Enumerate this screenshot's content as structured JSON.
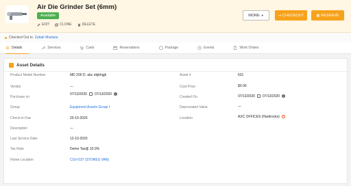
{
  "header": {
    "title": "Air Die Grinder Set (6mm)",
    "status_badge": "Available",
    "actions": {
      "edit": "EDIT",
      "clone": "CLONE",
      "delete": "DELETE"
    },
    "more_label": "MORE",
    "checkout_label": "CHECKOUT",
    "reserve_label": "RESERVE"
  },
  "checked_out": {
    "prefix": "Checked Out to",
    "person": "Zubair Murtaza"
  },
  "tabs": [
    {
      "label": "Details",
      "icon": "list-icon",
      "active": true
    },
    {
      "label": "Services",
      "icon": "wrench-icon"
    },
    {
      "label": "Carts",
      "icon": "cart-icon"
    },
    {
      "label": "Reservations",
      "icon": "calendar-icon"
    },
    {
      "label": "Package",
      "icon": "package-icon"
    },
    {
      "label": "Events",
      "icon": "history-icon"
    },
    {
      "label": "Work Orders",
      "icon": "clipboard-icon"
    }
  ],
  "asset_details": {
    "title": "Asset Details",
    "left": [
      {
        "label": "Product Model Number",
        "value": "MD 200 D. abc nbjkhgjk"
      },
      {
        "label": "Vendor",
        "value": "---"
      },
      {
        "label": "Purchase on",
        "date1": "07/13/2020",
        "date2": "07/13/2020"
      },
      {
        "label": "Group",
        "value": "Equipment Assets Group I"
      },
      {
        "label": "Check-in Due",
        "value": "20-10-2020"
      },
      {
        "label": "Description",
        "value": "---"
      },
      {
        "label": "Last Service Date",
        "value": "12-10-2020"
      },
      {
        "label": "Tax Rate",
        "value": "Demo Tax@ 10.0%"
      },
      {
        "label": "Home Location",
        "value": "CGV-037 (STORES VAN)"
      }
    ],
    "right": [
      {
        "label": "Asset #",
        "value": "631"
      },
      {
        "label": "Cost Price",
        "value": "$0.00"
      },
      {
        "label": "Created On",
        "date1": "07/13/2020",
        "date2": "07/13/2020"
      },
      {
        "label": "Depreciated Value",
        "value": "---"
      },
      {
        "label": "Location",
        "value": "AXC OFFICES (Hardrocks)"
      }
    ]
  },
  "colors": {
    "accent": "#f7a21b",
    "link": "#1e6fd9",
    "badge": "#4caf50"
  }
}
